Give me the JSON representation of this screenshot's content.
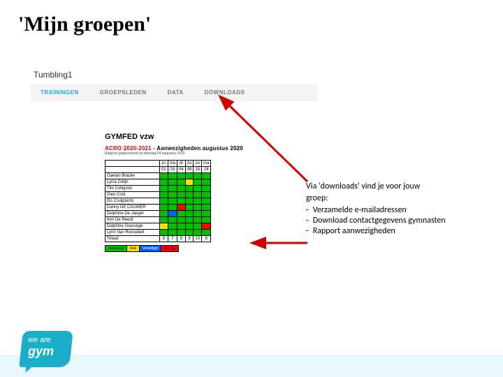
{
  "title": "'Mijn groepen'",
  "panel": {
    "group_name": "Tumbling1",
    "tabs": [
      "TRAININGEN",
      "GROEPSLEDEN",
      "DATA",
      "DOWNLOADS"
    ],
    "active_tab": 0
  },
  "doc": {
    "org": "GYMFED vzw",
    "head_red": "ACRO 2020-2021",
    "head_rest": " - Aanwezigheden augustus 2020",
    "sub": "Rapport gegenereerd op dinsdag 04 augustus 2020",
    "day_labels": [
      "zo",
      "ma",
      "di",
      "zo",
      "zo",
      "ma"
    ],
    "day_nums": [
      "02",
      "03",
      "04",
      "09",
      "15",
      "24"
    ],
    "rows": [
      {
        "name": "Gaetan Bracke",
        "c": [
          "g",
          "g",
          "g",
          "g",
          "g",
          "g"
        ]
      },
      {
        "name": "Lycia Colijn",
        "c": [
          "g",
          "g",
          "g",
          "y",
          "g",
          "g"
        ]
      },
      {
        "name": "Tim Collignon",
        "c": [
          "g",
          "g",
          "g",
          "g",
          "g",
          "g"
        ]
      },
      {
        "name": "Dien Cool",
        "c": [
          "g",
          "g",
          "g",
          "g",
          "g",
          "g"
        ]
      },
      {
        "name": "Els Cruijplants",
        "c": [
          "g",
          "g",
          "g",
          "g",
          "g",
          "g"
        ]
      },
      {
        "name": "Danny DE CAUWER",
        "c": [
          "g",
          "g",
          "r",
          "g",
          "g",
          "g"
        ]
      },
      {
        "name": "Delphine De Jaeger",
        "c": [
          "g",
          "b",
          "g",
          "g",
          "g",
          "g"
        ]
      },
      {
        "name": "Kim De Reedt",
        "c": [
          "g",
          "g",
          "g",
          "g",
          "g",
          "g"
        ]
      },
      {
        "name": "Delphine Grassége",
        "c": [
          "y",
          "g",
          "g",
          "g",
          "g",
          "r"
        ]
      },
      {
        "name": "Lynn Van Roosebelt",
        "c": [
          "g",
          "g",
          "g",
          "g",
          "g",
          "g"
        ]
      }
    ],
    "total_label": "Totaal:",
    "totals": [
      "9",
      "7",
      "8",
      "9",
      "10",
      "8"
    ],
    "legend": [
      "Aanwezig",
      "Ziek",
      "Verwittigd",
      "Nw. tijg"
    ]
  },
  "callout": {
    "intro1": "Via 'downloads' vind je voor jouw",
    "intro2": "groep:",
    "items": [
      "Verzamelde e-mailadressen",
      "Download contactgegevens gymnasten",
      "Rapport aanwezigheden"
    ]
  },
  "logo": {
    "line1": "we are",
    "line2": "gym"
  }
}
